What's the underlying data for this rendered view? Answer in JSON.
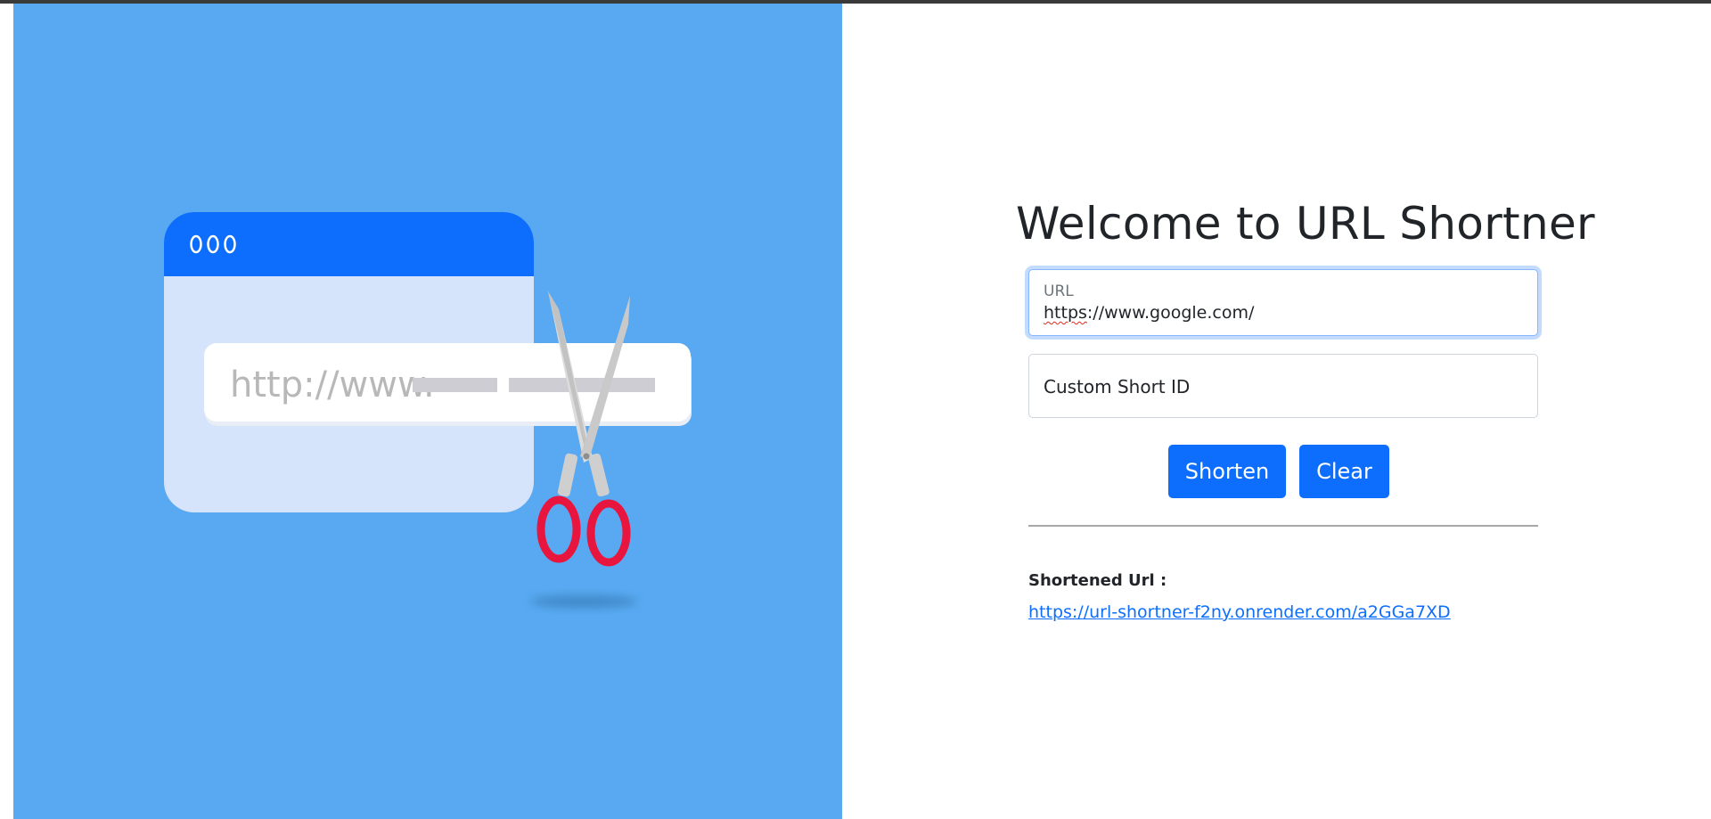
{
  "page": {
    "title": "Welcome to URL Shortner"
  },
  "hero": {
    "illustration_text": "http://www.",
    "colors": {
      "background": "#58a9f1",
      "window_header": "#0d6efd",
      "window_body": "#d5e3fb",
      "scissor_handles": "#e8163f"
    }
  },
  "form": {
    "url_label": "URL",
    "url_value_scheme": "https",
    "url_value_rest": "://www.google.com/",
    "custom_id_placeholder": "Custom Short ID",
    "shorten_label": "Shorten",
    "clear_label": "Clear"
  },
  "result": {
    "label": "Shortened Url :",
    "link": "https://url-shortner-f2ny.onrender.com/a2GGa7XD"
  },
  "colors": {
    "accent": "#0d6efd",
    "text": "#212529"
  }
}
